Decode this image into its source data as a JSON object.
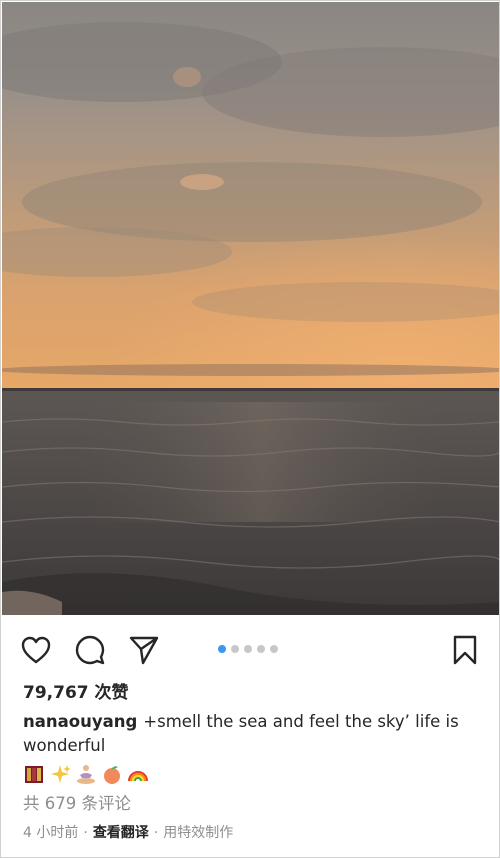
{
  "post": {
    "image_alt": "sunset over the sea",
    "carousel": {
      "total": 5,
      "current": 1
    },
    "likes_text": "79,767 次赞",
    "caption": {
      "username": "nanaouyang",
      "text": "+smell the sea and feel the sky’ life is wonderful",
      "emojis": [
        "book-stack-emoji",
        "sparkles-emoji",
        "meditation-emoji",
        "peach-emoji",
        "rainbow-emoji"
      ]
    },
    "comments_text": "共 679 条评论",
    "meta": {
      "time": "4 小时前",
      "separator": "·",
      "translate": "查看翻译",
      "separator2": "·",
      "special_effects": "用特效制作"
    }
  },
  "colors": {
    "accent": "#3897f0",
    "muted": "#8e8e8e",
    "text": "#262626"
  }
}
